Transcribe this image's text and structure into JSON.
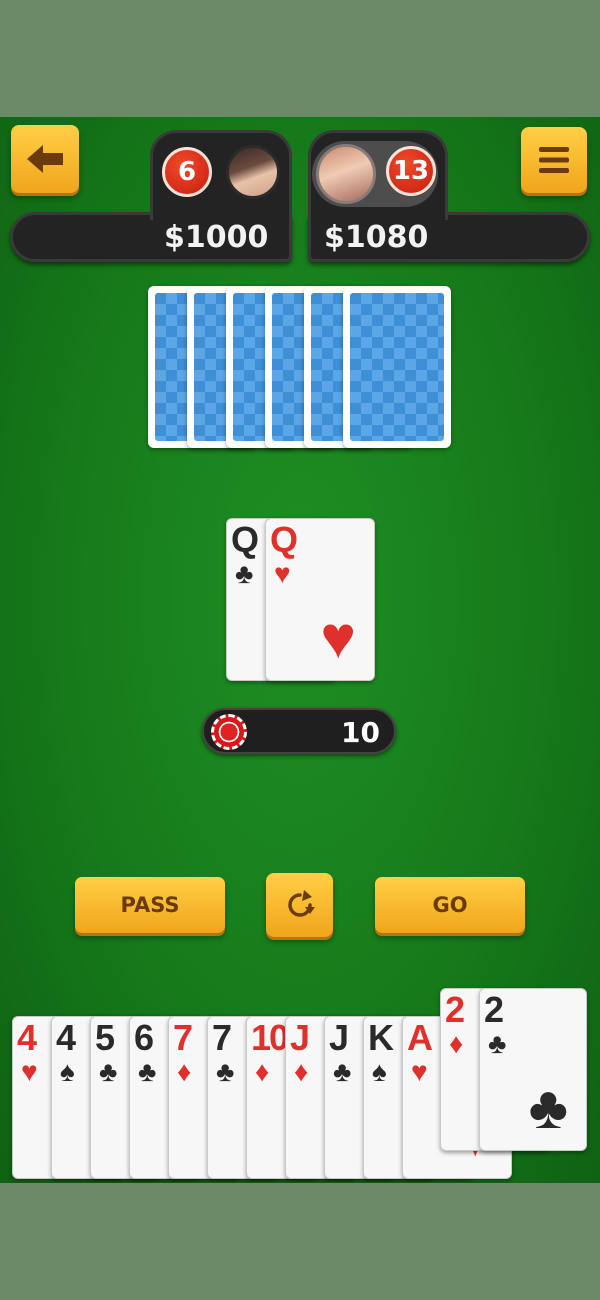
{
  "players": {
    "left": {
      "card_count": "6",
      "money": "$1000"
    },
    "right": {
      "card_count": "13",
      "money": "$1080"
    }
  },
  "opponent_cards_shown": 6,
  "table_cards": [
    {
      "rank": "Q",
      "suit": "♣",
      "color": "black"
    },
    {
      "rank": "Q",
      "suit": "♥",
      "color": "red"
    }
  ],
  "pot": "10",
  "buttons": {
    "pass": "PASS",
    "go": "GO"
  },
  "hand": [
    {
      "rank": "4",
      "suit": "♥",
      "color": "red"
    },
    {
      "rank": "4",
      "suit": "♠",
      "color": "black"
    },
    {
      "rank": "5",
      "suit": "♣",
      "color": "black"
    },
    {
      "rank": "6",
      "suit": "♣",
      "color": "black"
    },
    {
      "rank": "7",
      "suit": "♦",
      "color": "red"
    },
    {
      "rank": "7",
      "suit": "♣",
      "color": "black"
    },
    {
      "rank": "10",
      "suit": "♦",
      "color": "red"
    },
    {
      "rank": "J",
      "suit": "♦",
      "color": "red"
    },
    {
      "rank": "J",
      "suit": "♣",
      "color": "black"
    },
    {
      "rank": "K",
      "suit": "♠",
      "color": "black"
    },
    {
      "rank": "A",
      "suit": "♥",
      "color": "red"
    },
    {
      "rank": "2",
      "suit": "♦",
      "color": "red",
      "selected": true
    },
    {
      "rank": "2",
      "suit": "♣",
      "color": "black",
      "selected": true
    }
  ],
  "icons": {
    "back": "arrow-left-icon",
    "menu": "hamburger-icon",
    "sort": "rotate-icon"
  },
  "colors": {
    "felt": "#167a1a",
    "button": "#f7b82c",
    "red": "#e0302c"
  }
}
